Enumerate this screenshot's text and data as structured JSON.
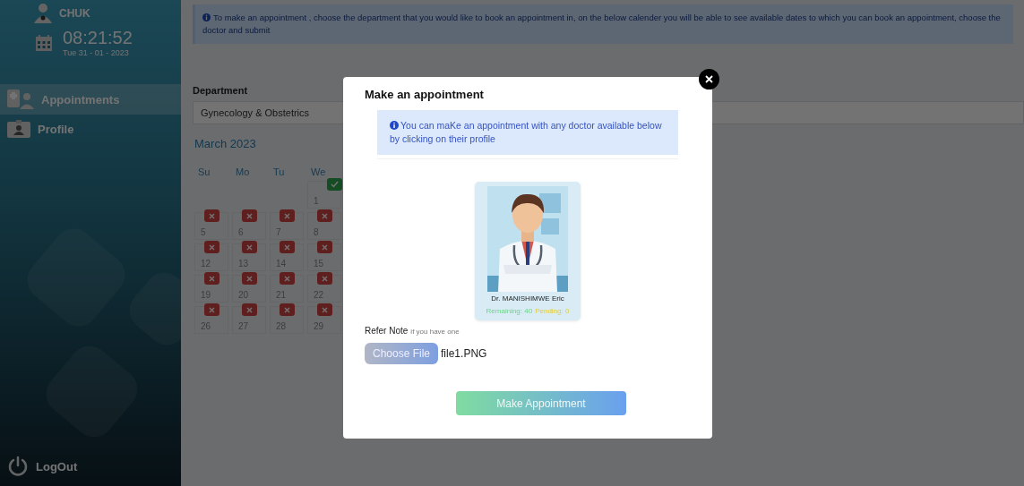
{
  "sidebar": {
    "brand": "CHUK",
    "time": "08:21:52",
    "date": "Tue 31 - 01 - 2023",
    "items": [
      {
        "label": "Appointments",
        "selected": true
      },
      {
        "label": "Profile",
        "selected": false
      }
    ],
    "logout": "LogOut"
  },
  "main": {
    "notice": "To make an appointment , choose the department that you would like to book an appointment in, on the below calender you will be able to see available dates to which you can book an appointment, choose the doctor and submit",
    "department_label": "Department",
    "department_value": "Gynecology & Obstetrics",
    "calendar": {
      "month": "March 2023",
      "weekdays": [
        "Su",
        "Mo",
        "Tu",
        "We"
      ],
      "weeks": [
        [
          {
            "kind": "blank"
          },
          {
            "kind": "blank"
          },
          {
            "kind": "blank"
          },
          {
            "kind": "day",
            "label": "1",
            "available": true
          }
        ],
        [
          {
            "kind": "day",
            "label": "5",
            "available": false
          },
          {
            "kind": "day",
            "label": "6",
            "available": false
          },
          {
            "kind": "day",
            "label": "7",
            "available": false
          },
          {
            "kind": "day",
            "label": "8",
            "available": false
          }
        ],
        [
          {
            "kind": "day",
            "label": "12",
            "available": false
          },
          {
            "kind": "day",
            "label": "13",
            "available": false
          },
          {
            "kind": "day",
            "label": "14",
            "available": false
          },
          {
            "kind": "day",
            "label": "15",
            "available": false
          }
        ],
        [
          {
            "kind": "day",
            "label": "19",
            "available": false
          },
          {
            "kind": "day",
            "label": "20",
            "available": false
          },
          {
            "kind": "day",
            "label": "21",
            "available": false
          },
          {
            "kind": "day",
            "label": "22",
            "available": false
          }
        ],
        [
          {
            "kind": "day",
            "label": "26",
            "available": false
          },
          {
            "kind": "day",
            "label": "27",
            "available": false
          },
          {
            "kind": "day",
            "label": "28",
            "available": false
          },
          {
            "kind": "day",
            "label": "29",
            "available": false
          }
        ]
      ]
    }
  },
  "modal": {
    "title": "Make an appointment",
    "alert": "You can maKe an appointment with any doctor available below by clicking on their profile",
    "doctors": [
      {
        "name": "Dr. MANISHIMWE Eric",
        "remaining": "Remaining: 40",
        "pending": "Pending: 0"
      }
    ],
    "note_label": "Refer Note",
    "note_hint": "if you have one",
    "file_button": "Choose File",
    "file_name": "file1.PNG",
    "submit": "Make Appointment"
  }
}
